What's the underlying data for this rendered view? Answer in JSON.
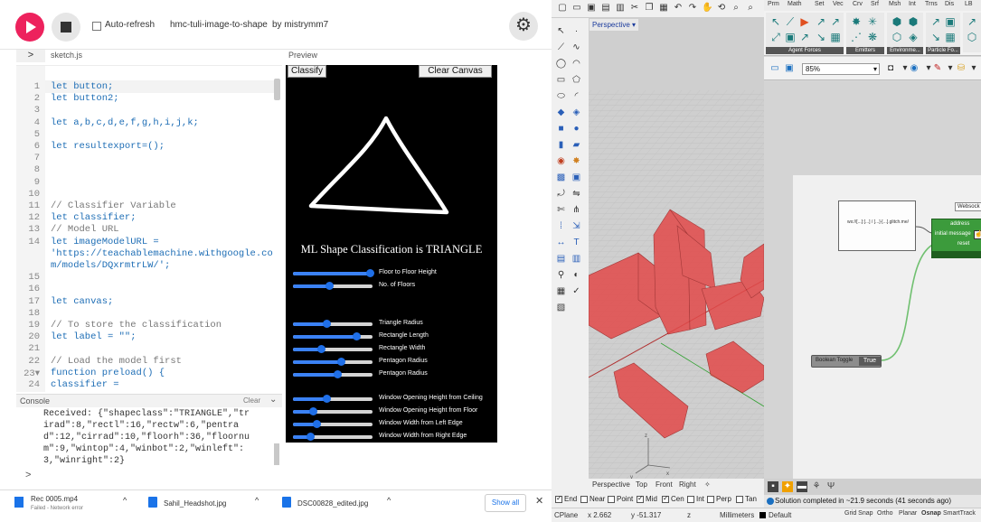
{
  "p5": {
    "auto_refresh_label": "Auto-refresh",
    "sketch_title": "hmc-tuli-image-to-shape",
    "author": "by mistrymm7",
    "file_name": "sketch.js",
    "preview_label": "Preview",
    "toggle_glyph": ">",
    "settings_glyph": "⚙",
    "code_lines": [
      {
        "n": "1",
        "text": "let button;",
        "style": "kw"
      },
      {
        "n": "2",
        "text": "let button2;",
        "style": "kw"
      },
      {
        "n": "3",
        "text": "",
        "style": ""
      },
      {
        "n": "4",
        "text": "let a,b,c,d,e,f,g,h,i,j,k;",
        "style": "kw"
      },
      {
        "n": "5",
        "text": "",
        "style": ""
      },
      {
        "n": "6",
        "text": "let resultexport=();",
        "style": "kw"
      },
      {
        "n": "7",
        "text": "",
        "style": ""
      },
      {
        "n": "8",
        "text": "",
        "style": ""
      },
      {
        "n": "9",
        "text": "",
        "style": ""
      },
      {
        "n": "10",
        "text": "",
        "style": ""
      },
      {
        "n": "11",
        "text": "// Classifier Variable",
        "style": "cm"
      },
      {
        "n": "12",
        "text": "let classifier;",
        "style": "kw"
      },
      {
        "n": "13",
        "text": "// Model URL",
        "style": "cm"
      },
      {
        "n": "14",
        "text": "let imageModelURL =",
        "style": "kw"
      },
      {
        "n": "",
        "text": "'https://teachablemachine.withgoogle.co",
        "style": "str"
      },
      {
        "n": "",
        "text": "m/models/DQxrmtrLW/';",
        "style": "str"
      },
      {
        "n": "15",
        "text": "",
        "style": ""
      },
      {
        "n": "16",
        "text": "",
        "style": ""
      },
      {
        "n": "17",
        "text": "let canvas;",
        "style": "kw"
      },
      {
        "n": "18",
        "text": "",
        "style": ""
      },
      {
        "n": "19",
        "text": "// To store the classification",
        "style": "cm"
      },
      {
        "n": "20",
        "text": "let label = \"\";",
        "style": "kw"
      },
      {
        "n": "21",
        "text": "",
        "style": ""
      },
      {
        "n": "22",
        "text": "// Load the model first",
        "style": "cm"
      },
      {
        "n": "23▾",
        "text": "function preload() {",
        "style": "kw"
      },
      {
        "n": "24",
        "text": "  classifier =",
        "style": "kw"
      }
    ],
    "console": {
      "title": "Console",
      "clear": "Clear",
      "chevron": "⌄",
      "lines": [
        "Received: {\"shapeclass\":\"TRIANGLE\",\"tr",
        "irad\":8,\"rectl\":16,\"rectw\":6,\"pentra",
        "d\":12,\"cirrad\":10,\"floorh\":36,\"floornu",
        "m\":9,\"wintop\":4,\"winbot\":2,\"winleft\":",
        "3,\"winright\":2}"
      ],
      "prompt": ">"
    },
    "sketch": {
      "classify_label": "Classify",
      "clear_label": "Clear Canvas",
      "result_text": "ML Shape Classification is TRIANGLE",
      "sliders": [
        {
          "label": "Floor to Floor Height",
          "value": 0.97
        },
        {
          "label": "No. of Floors",
          "value": 0.45
        },
        {
          "label": "Triangle Radius",
          "value": 0.42
        },
        {
          "label": "Rectangle Length",
          "value": 0.8
        },
        {
          "label": "Rectangle Width",
          "value": 0.35
        },
        {
          "label": "Pentagon Radius",
          "value": 0.6
        },
        {
          "label": "Pentagon Radius",
          "value": 0.56
        },
        {
          "label": "Window Opening Height from Ceiling",
          "value": 0.42
        },
        {
          "label": "Window Opening Height from Floor",
          "value": 0.25
        },
        {
          "label": "Window Width from Left Edge",
          "value": 0.3
        },
        {
          "label": "Window Width from Right Edge",
          "value": 0.22
        }
      ]
    }
  },
  "downloads": [
    {
      "name": "Rec 0005.mp4",
      "sub": "Failed - Network error"
    },
    {
      "name": "Sahil_Headshot.jpg",
      "sub": ""
    },
    {
      "name": "DSC00828_edited.jpg",
      "sub": ""
    }
  ],
  "downloads_show_all": "Show all",
  "downloads_close": "✕",
  "downloads_caret": "^",
  "rhino": {
    "viewport_label": "Perspective ▾",
    "viewport_tabs": [
      "Perspective",
      "Top",
      "Front",
      "Right",
      "✧"
    ],
    "osnaps": [
      {
        "label": "End",
        "on": true
      },
      {
        "label": "Near",
        "on": false
      },
      {
        "label": "Point",
        "on": false
      },
      {
        "label": "Mid",
        "on": true
      },
      {
        "label": "Cen",
        "on": true
      },
      {
        "label": "Int",
        "on": false
      },
      {
        "label": "Perp",
        "on": false
      },
      {
        "label": "Tan",
        "on": false
      }
    ],
    "status": {
      "cplane": "CPlane",
      "x": "x 2.662",
      "y": "y -51.317",
      "z": "z",
      "units": "Millimeters",
      "layer": "Default",
      "snaps": [
        "Grid Snap",
        "Ortho",
        "Planar",
        "Osnap",
        "SmartTrack"
      ]
    }
  },
  "gh": {
    "tabs": [
      "Prm",
      "Math",
      "Set",
      "Vec",
      "Crv",
      "Srf",
      "Msh",
      "Int",
      "Trns",
      "Dis",
      "LB"
    ],
    "ribbon_captions": [
      "Agent Forces",
      "Emitters",
      "Environme...",
      "Particle Fo..."
    ],
    "zoom": "85%",
    "panel_text": "ws://[...]:[...] / [...]-[...].glitch.me/",
    "ws_title": "Websock",
    "ws_params": [
      "address",
      "initial message",
      "reset"
    ],
    "bool_label": "Boolean Toggle",
    "bool_value": "True",
    "status": "Solution completed in ~21.9 seconds (41 seconds ago)"
  }
}
